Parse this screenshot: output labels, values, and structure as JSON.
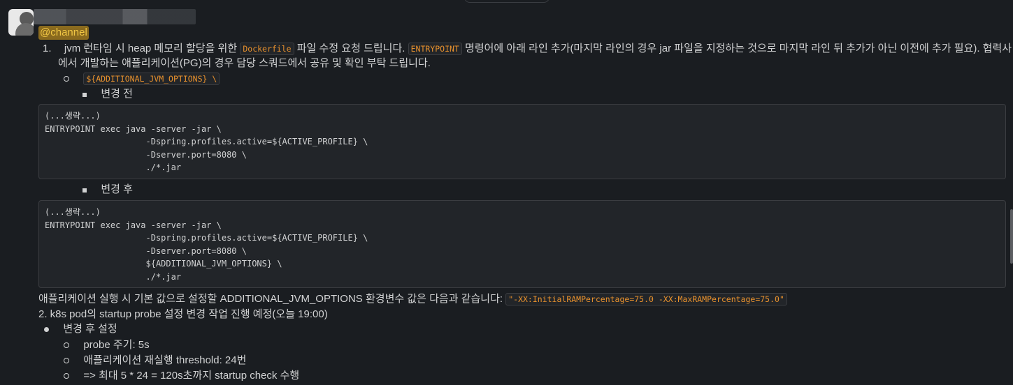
{
  "message": {
    "mention": "@channel",
    "item1": {
      "number": "1.",
      "text_a": "jvm 런타임 시 heap 메모리 할당을 위한 ",
      "code_dockerfile": "Dockerfile",
      "text_b": " 파일 수정 요청 드립니다. ",
      "code_entrypoint": "ENTRYPOINT",
      "text_c": " 명령어에 아래 라인 추가(마지막 라인의 경우 jar 파일을 지정하는 것으로 마지막 라인 뒤 추가가 아닌 이전에 추가 필요). 협력사",
      "text_d": "에서 개발하는 애플리케이션(PG)의 경우 담당 스쿼드에서 공유 및 확인 부탁 드립니다.",
      "sub_code": "${ADDITIONAL_JVM_OPTIONS} \\",
      "before_label": "변경 전",
      "before_code": "(...생략...)\nENTRYPOINT exec java -server -jar \\\n                    -Dspring.profiles.active=${ACTIVE_PROFILE} \\\n                    -Dserver.port=8080 \\\n                    ./*.jar",
      "after_label": "변경 후",
      "after_code": "(...생략...)\nENTRYPOINT exec java -server -jar \\\n                    -Dspring.profiles.active=${ACTIVE_PROFILE} \\\n                    -Dserver.port=8080 \\\n                    ${ADDITIONAL_JVM_OPTIONS} \\\n                    ./*.jar"
    },
    "env_text": "애플리케이션 실행 시 기본 값으로 설정할 ADDITIONAL_JVM_OPTIONS 환경변수 값은 다음과 같습니다: ",
    "env_code": "\"-XX:InitialRAMPercentage=75.0 -XX:MaxRAMPercentage=75.0\"",
    "item2": "2. k8s pod의 startup probe 설정 변경 작업 진행 예정(오늘 19:00)",
    "settings_label": "변경 후 설정",
    "settings": [
      "probe 주기: 5s",
      "애플리케이션 재실행 threshold: 24번",
      "=> 최대 5 * 24 =  120s초까지 startup check 수행"
    ]
  }
}
